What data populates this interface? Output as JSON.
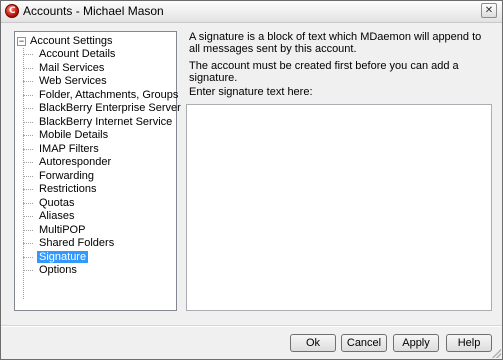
{
  "window": {
    "title": "Accounts - Michael Mason",
    "close_glyph": "✕"
  },
  "tree": {
    "root_label": "Account Settings",
    "expander_glyph": "−",
    "items": [
      {
        "label": "Account Details"
      },
      {
        "label": "Mail Services"
      },
      {
        "label": "Web Services"
      },
      {
        "label": "Folder, Attachments, Groups"
      },
      {
        "label": "BlackBerry Enterprise Server"
      },
      {
        "label": "BlackBerry Internet Service"
      },
      {
        "label": "Mobile Details"
      },
      {
        "label": "IMAP Filters"
      },
      {
        "label": "Autoresponder"
      },
      {
        "label": "Forwarding"
      },
      {
        "label": "Restrictions"
      },
      {
        "label": "Quotas"
      },
      {
        "label": "Aliases"
      },
      {
        "label": "MultiPOP"
      },
      {
        "label": "Shared Folders"
      },
      {
        "label": "Signature"
      },
      {
        "label": "Options"
      }
    ],
    "selected": "Signature"
  },
  "signature": {
    "description": "A signature is a block of text which MDaemon will append to all messages sent by this account.",
    "notice": "The account must be created first before you can add a signature.",
    "input_label": "Enter signature text here:",
    "text": ""
  },
  "buttons": {
    "ok": "Ok",
    "cancel": "Cancel",
    "apply": "Apply",
    "help": "Help"
  },
  "colors": {
    "selection": "#3399ff",
    "window_bg": "#f0f0f0"
  }
}
